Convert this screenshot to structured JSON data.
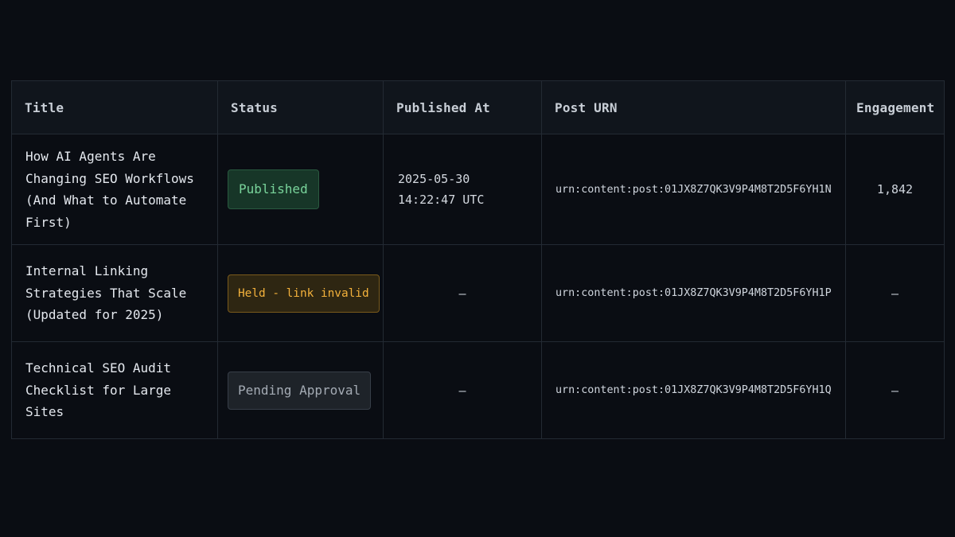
{
  "table": {
    "headers": [
      "Title",
      "Status",
      "Published At",
      "Post URN",
      "Engagement"
    ],
    "rows": [
      {
        "title": "How AI Agents Are Changing SEO Workflows (And What to Automate First)",
        "status": "Published",
        "published_at": "2025-05-30 14:22:47 UTC",
        "urn": "urn:content:post:01JX8Z7QK3V9P4M8T2D5F6YH1N",
        "engagement": "1,842"
      },
      {
        "title": "Internal Linking Strategies That Scale (Updated for 2025)",
        "status": "Held - link invalid",
        "published_at": "—",
        "urn": "urn:content:post:01JX8Z7QK3V9P4M8T2D5F6YH1P",
        "engagement": "—"
      },
      {
        "title": "Technical SEO Audit Checklist for Large Sites",
        "status": "Pending Approval",
        "published_at": "—",
        "urn": "urn:content:post:01JX8Z7QK3V9P4M8T2D5F6YH1Q",
        "engagement": "—"
      }
    ]
  },
  "colors": {
    "background": "#0a0d13",
    "published": "#79d49b",
    "held": "#f3b13b",
    "pending": "#a4abb4"
  }
}
